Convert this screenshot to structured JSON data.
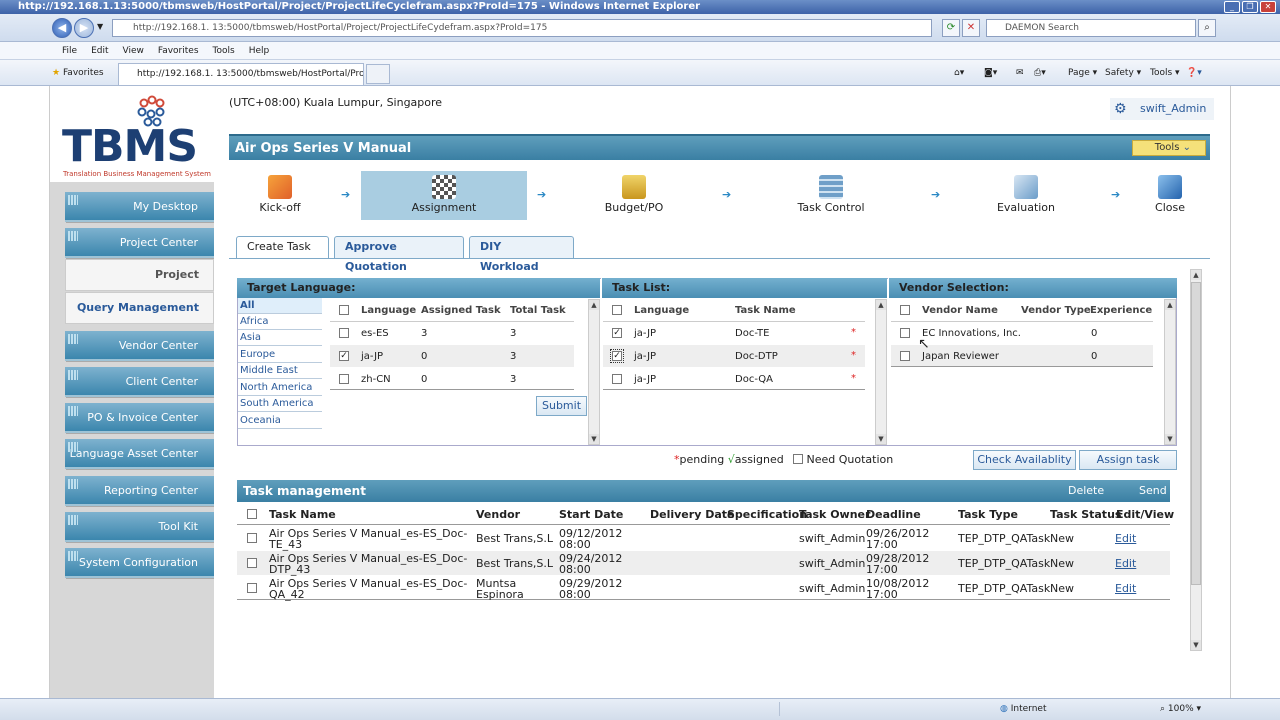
{
  "browser": {
    "title": "http://192.168.1.13:5000/tbmsweb/HostPortal/Project/ProjectLifeCyclefram.aspx?ProId=175 - Windows Internet Explorer",
    "url": "http://192.168.1. 13:5000/tbmsweb/HostPortal/Project/ProjectLifeCydefram.aspx?ProId=175",
    "search_placeholder": "DAEMON Search",
    "menu": [
      "File",
      "Edit",
      "View",
      "Favorites",
      "Tools",
      "Help"
    ],
    "favorites_label": "Favorites",
    "tab_title": "http://192.168.1. 13:5000/tbmsweb/HostPortal/Proje...",
    "commands": {
      "page": "Page",
      "safety": "Safety",
      "tools": "Tools"
    },
    "status_zone": "Internet",
    "zoom": "100%"
  },
  "logo": {
    "name": "TBMS",
    "tagline": "Translation Business Management System"
  },
  "sidebar": {
    "items": [
      {
        "label": "My Desktop"
      },
      {
        "label": "Project Center"
      },
      {
        "label": "Vendor Center"
      },
      {
        "label": "Client Center"
      },
      {
        "label": "PO & Invoice Center"
      },
      {
        "label": "Language Asset Center"
      },
      {
        "label": "Reporting Center"
      },
      {
        "label": "Tool Kit"
      },
      {
        "label": "System Configuration"
      }
    ],
    "sub": {
      "project_management": "Project Management",
      "query_management": "Query Management"
    }
  },
  "header": {
    "timezone": "(UTC+08:00) Kuala Lumpur, Singapore",
    "user": "swift_Admin"
  },
  "project": {
    "title": "Air Ops Series V Manual",
    "tools_label": "Tools"
  },
  "steps": [
    "Kick-off",
    "Assignment",
    "Budget/PO",
    "Task Control",
    "Evaluation",
    "Close"
  ],
  "tabs": [
    "Create Task",
    "Approve Quotation",
    "DIY Workload"
  ],
  "target_language": {
    "title": "Target Language:",
    "regions": [
      "All",
      "Africa",
      "Asia",
      "Europe",
      "Middle East",
      "North America",
      "South America",
      "Oceania"
    ],
    "columns": [
      "Language",
      "Assigned Task",
      "Total Task"
    ],
    "rows": [
      {
        "lang": "es-ES",
        "assigned": "3",
        "total": "3",
        "checked": false
      },
      {
        "lang": "ja-JP",
        "assigned": "0",
        "total": "3",
        "checked": true
      },
      {
        "lang": "zh-CN",
        "assigned": "0",
        "total": "3",
        "checked": false
      }
    ],
    "submit": "Submit"
  },
  "task_list": {
    "title": "Task List:",
    "columns": [
      "Language",
      "Task Name"
    ],
    "rows": [
      {
        "lang": "ja-JP",
        "task": "Doc-TE",
        "mark": "*",
        "checked": true
      },
      {
        "lang": "ja-JP",
        "task": "Doc-DTP",
        "mark": "*",
        "checked": true
      },
      {
        "lang": "ja-JP",
        "task": "Doc-QA",
        "mark": "*",
        "checked": false
      }
    ]
  },
  "vendor_selection": {
    "title": "Vendor Selection:",
    "columns": [
      "Vendor Name",
      "Vendor Type",
      "Experience"
    ],
    "rows": [
      {
        "name": "EC Innovations, Inc.",
        "experience": "0"
      },
      {
        "name": "Japan Reviewer",
        "experience": "0"
      }
    ]
  },
  "legend": {
    "pending": "pending",
    "assigned": "assigned",
    "pending_mark": "*",
    "assigned_mark": "√",
    "need_quotation": "Need Quotation"
  },
  "actions": {
    "check": "Check Availablity",
    "assign": "Assign task"
  },
  "task_management": {
    "title": "Task management",
    "delete": "Delete",
    "send": "Send",
    "columns": [
      "Task Name",
      "Vendor",
      "Start Date",
      "Delivery Date",
      "Specification",
      "Task Owner",
      "Deadline",
      "Task Type",
      "Task Status",
      "Edit/View"
    ],
    "rows": [
      {
        "name1": "Air Ops Series V Manual_es-ES_Doc-",
        "name2": "TE_43",
        "vendor1": "Best Trans,S.L",
        "vendor2": "",
        "start1": "09/12/2012",
        "start2": "08:00",
        "owner": "swift_Admin",
        "dead1": "09/26/2012",
        "dead2": "17:00",
        "type": "TEP_DTP_QATask",
        "status": "New",
        "edit": "Edit"
      },
      {
        "name1": "Air Ops Series V Manual_es-ES_Doc-",
        "name2": "DTP_43",
        "vendor1": "Best Trans,S.L",
        "vendor2": "",
        "start1": "09/24/2012",
        "start2": "08:00",
        "owner": "swift_Admin",
        "dead1": "09/28/2012",
        "dead2": "17:00",
        "type": "TEP_DTP_QATask",
        "status": "New",
        "edit": "Edit"
      },
      {
        "name1": "Air Ops Series V Manual_es-ES_Doc-",
        "name2": "QA_42",
        "vendor1": "Muntsa",
        "vendor2": "Espinora",
        "start1": "09/29/2012",
        "start2": "08:00",
        "owner": "swift_Admin",
        "dead1": "10/08/2012",
        "dead2": "17:00",
        "type": "TEP_DTP_QATask",
        "status": "New",
        "edit": "Edit"
      }
    ]
  }
}
